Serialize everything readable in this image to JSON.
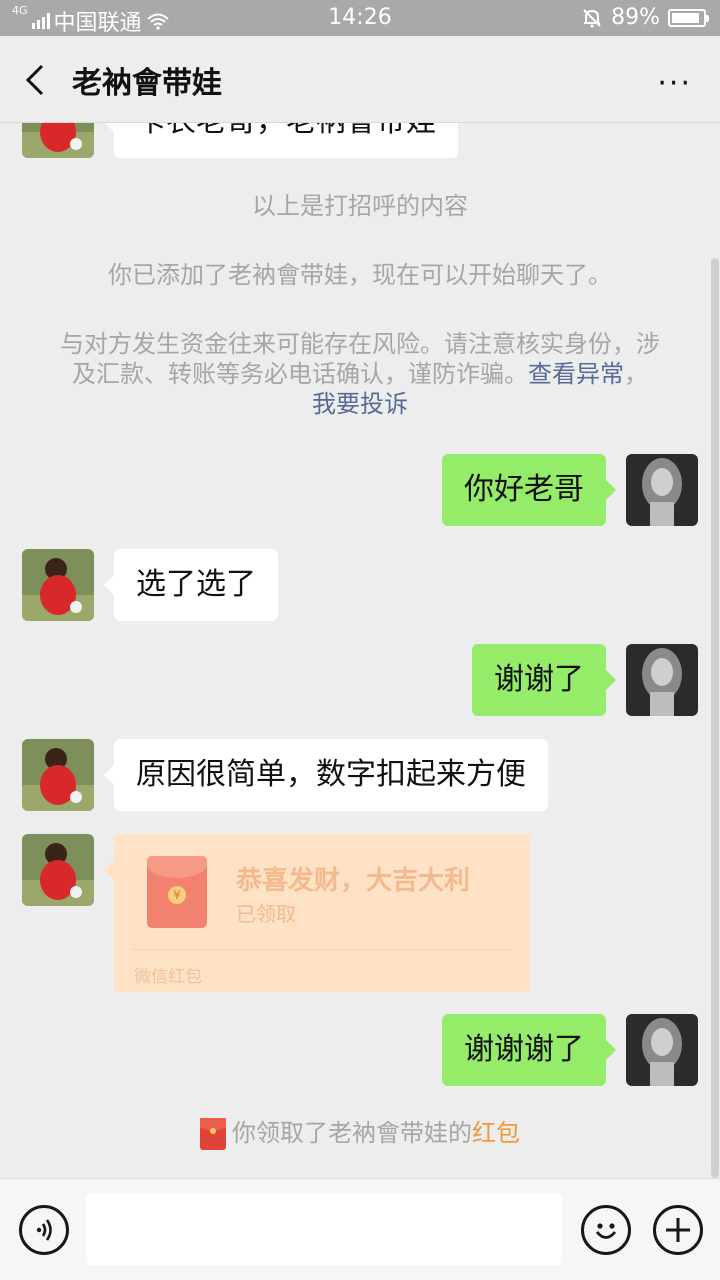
{
  "status_bar": {
    "network": "4G",
    "carrier": "中国联通",
    "time": "14:26",
    "battery": "89%",
    "battery_level": 0.89
  },
  "header": {
    "back_icon": "chevron-left-icon",
    "title": "老衲會带娃",
    "more_label": "···"
  },
  "chat": {
    "partial_message": "卡农老哥，老衲會带娃",
    "system_greeting": "以上是打招呼的内容",
    "system_added": "你已添加了老衲會带娃，现在可以开始聊天了。",
    "system_warning": "与对方发生资金往来可能存在风险。请注意核实身份，涉及汇款、转账等务必电话确认，谨防诈骗。",
    "link_report_abnormal": "查看异常",
    "link_complain": "我要投诉",
    "messages": [
      {
        "from": "me",
        "text": "你好老哥"
      },
      {
        "from": "them",
        "text": "选了选了"
      },
      {
        "from": "me",
        "text": "谢谢了"
      },
      {
        "from": "them",
        "text": "原因很简单，数字扣起来方便"
      },
      {
        "from": "me",
        "text": "谢谢谢了"
      }
    ],
    "red_packet": {
      "title": "恭喜发财，大吉大利",
      "status": "已领取",
      "footer": "微信红包",
      "coin_symbol": "¥"
    },
    "claim_notice": {
      "prefix": "你领取了老衲會带娃的",
      "highlight": "红包"
    }
  },
  "input_bar": {
    "voice_icon": "voice-icon",
    "emoji_icon": "emoji-icon",
    "plus_icon": "plus-icon",
    "placeholder": ""
  },
  "colors": {
    "outgoing_bubble": "#95ec69",
    "incoming_bubble": "#ffffff",
    "background": "#ededed",
    "link": "#576b95",
    "red_packet_bg": "#fde2c5",
    "red_packet_highlight": "#f09a37"
  }
}
